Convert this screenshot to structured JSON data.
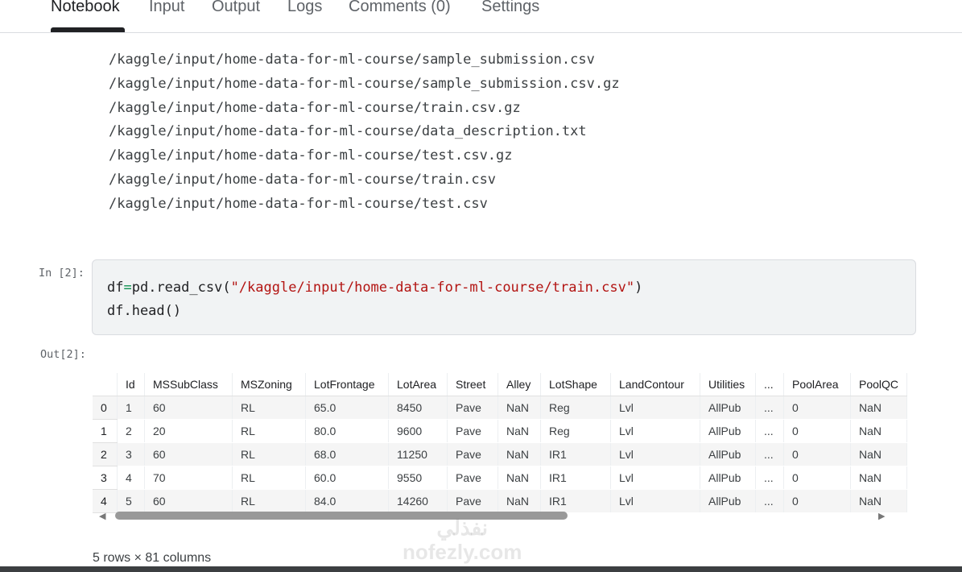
{
  "tabs": [
    {
      "label": "Notebook"
    },
    {
      "label": "Input"
    },
    {
      "label": "Output"
    },
    {
      "label": "Logs"
    },
    {
      "label": "Comments (0)"
    },
    {
      "label": "Settings"
    }
  ],
  "file_paths": [
    "/kaggle/input/home-data-for-ml-course/sample_submission.csv",
    "/kaggle/input/home-data-for-ml-course/sample_submission.csv.gz",
    "/kaggle/input/home-data-for-ml-course/train.csv.gz",
    "/kaggle/input/home-data-for-ml-course/data_description.txt",
    "/kaggle/input/home-data-for-ml-course/test.csv.gz",
    "/kaggle/input/home-data-for-ml-course/train.csv",
    "/kaggle/input/home-data-for-ml-course/test.csv"
  ],
  "cell": {
    "in_prompt": "In [2]:",
    "out_prompt": "Out[2]:",
    "line1_var": "df",
    "line1_op": "=",
    "line1_call": "pd.read_csv(",
    "line1_str": "\"/kaggle/input/home-data-for-ml-course/train.csv\"",
    "line1_end": ")",
    "line2": "df.head()"
  },
  "table": {
    "columns": [
      "",
      "Id",
      "MSSubClass",
      "MSZoning",
      "LotFrontage",
      "LotArea",
      "Street",
      "Alley",
      "LotShape",
      "LandContour",
      "Utilities",
      "...",
      "PoolArea",
      "PoolQC"
    ],
    "rows": [
      [
        "0",
        "1",
        "60",
        "RL",
        "65.0",
        "8450",
        "Pave",
        "NaN",
        "Reg",
        "Lvl",
        "AllPub",
        "...",
        "0",
        "NaN"
      ],
      [
        "1",
        "2",
        "20",
        "RL",
        "80.0",
        "9600",
        "Pave",
        "NaN",
        "Reg",
        "Lvl",
        "AllPub",
        "...",
        "0",
        "NaN"
      ],
      [
        "2",
        "3",
        "60",
        "RL",
        "68.0",
        "11250",
        "Pave",
        "NaN",
        "IR1",
        "Lvl",
        "AllPub",
        "...",
        "0",
        "NaN"
      ],
      [
        "3",
        "4",
        "70",
        "RL",
        "60.0",
        "9550",
        "Pave",
        "NaN",
        "IR1",
        "Lvl",
        "AllPub",
        "...",
        "0",
        "NaN"
      ],
      [
        "4",
        "5",
        "60",
        "RL",
        "84.0",
        "14260",
        "Pave",
        "NaN",
        "IR1",
        "Lvl",
        "AllPub",
        "...",
        "0",
        "NaN"
      ]
    ],
    "footer": "5 rows × 81 columns"
  },
  "watermark": {
    "arabic": "نفذلي",
    "latin": "nofezly.com"
  }
}
